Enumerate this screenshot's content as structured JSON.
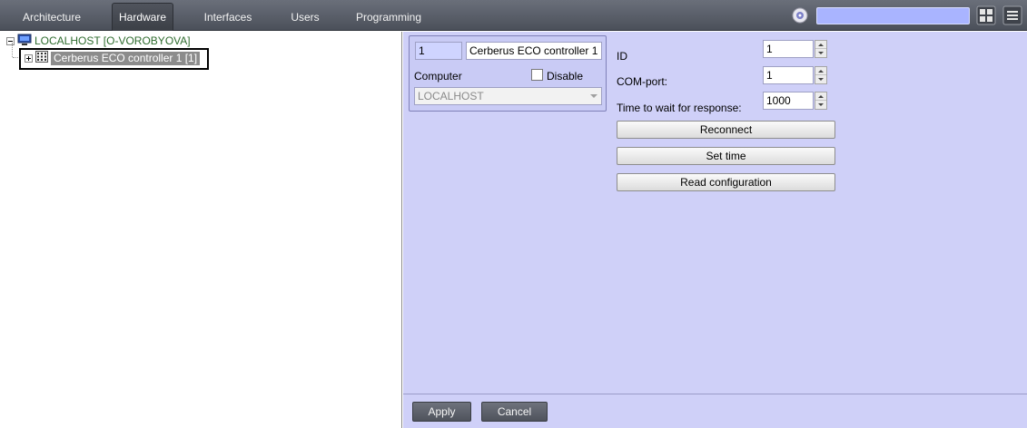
{
  "tabs": [
    {
      "label": "Architecture"
    },
    {
      "label": "Hardware"
    },
    {
      "label": "Interfaces"
    },
    {
      "label": "Users"
    },
    {
      "label": "Programming"
    }
  ],
  "active_tab": "Hardware",
  "search": {
    "value": ""
  },
  "tree": {
    "root_label": "LOCALHOST [O-VOROBYOVA]",
    "child_label": "Cerberus ECO controller 1 [1]"
  },
  "object": {
    "id_value": "1",
    "name_value": "Cerberus ECO controller 1",
    "computer_label": "Computer",
    "disable_label": "Disable",
    "computer_value": "LOCALHOST"
  },
  "settings": {
    "id_label": "ID",
    "id_value": "1",
    "com_label": "COM-port:",
    "com_value": "1",
    "timeout_label": "Time to wait for response:",
    "timeout_value": "1000",
    "reconnect_label": "Reconnect",
    "set_time_label": "Set time",
    "read_config_label": "Read configuration"
  },
  "footer": {
    "apply_label": "Apply",
    "cancel_label": "Cancel"
  },
  "colors": {
    "topbar": "#565b65",
    "panel_bg": "#cfd0f8",
    "tree_root": "#2e6b2e",
    "selection": "#8c8c8c"
  }
}
